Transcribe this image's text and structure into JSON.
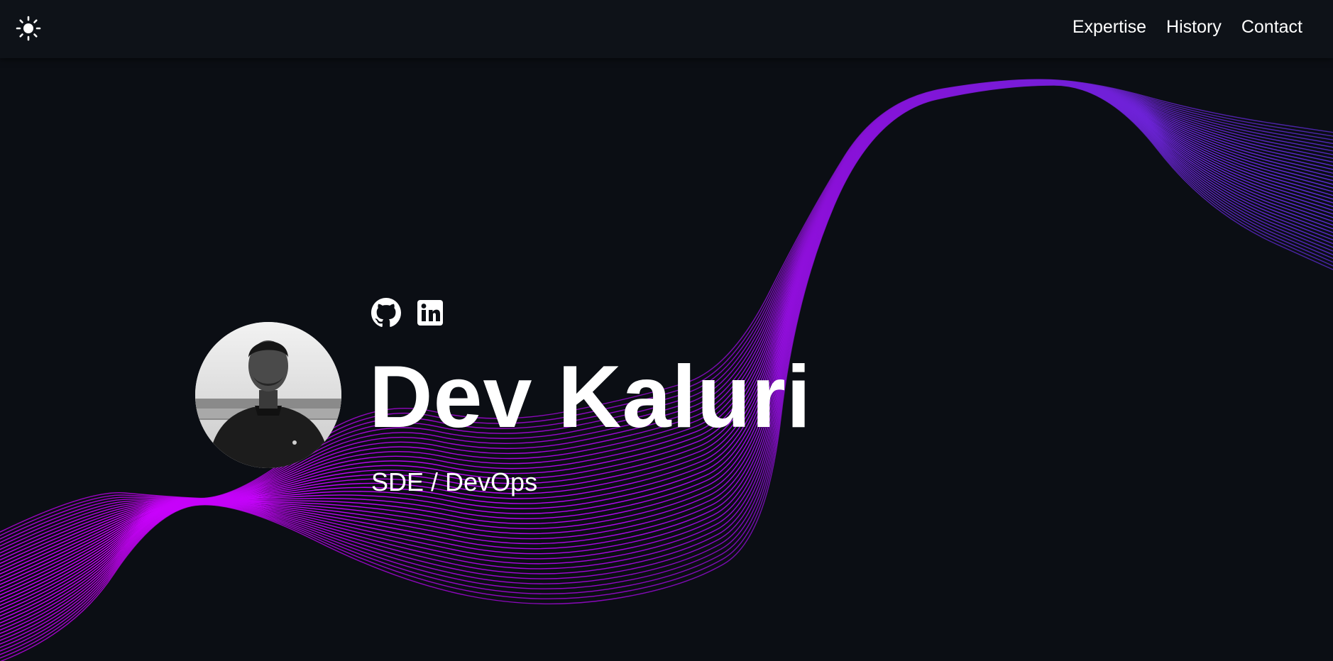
{
  "nav": {
    "theme_icon": "sun-icon",
    "links": [
      {
        "label": "Expertise"
      },
      {
        "label": "History"
      },
      {
        "label": "Contact"
      }
    ]
  },
  "hero": {
    "name": "Dev Kaluri",
    "role": "SDE / DevOps",
    "socials": [
      {
        "icon": "github-icon"
      },
      {
        "icon": "linkedin-icon"
      }
    ]
  },
  "colors": {
    "background": "#0b0e14",
    "navbar": "#0e1218",
    "wave_magenta": "#c000ff",
    "wave_purple": "#7a18d8",
    "wave_indigo": "#5b2bd6",
    "text": "#ffffff"
  }
}
